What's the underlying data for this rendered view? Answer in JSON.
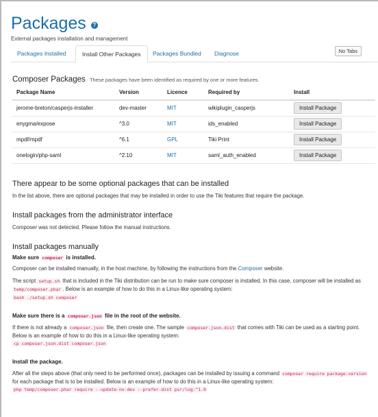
{
  "header": {
    "title": "Packages",
    "subtitle": "External packages installation and management"
  },
  "tabs": [
    {
      "label": "Packages Installed",
      "active": false
    },
    {
      "label": "Install Other Packages",
      "active": true
    },
    {
      "label": "Packages Bundled",
      "active": false
    },
    {
      "label": "Diagnose",
      "active": false
    }
  ],
  "no_tabs_label": "No Tabs",
  "composer_section": {
    "title": "Composer Packages",
    "note": "These packages have been identified as required by one or more features.",
    "columns": [
      "Package Name",
      "Version",
      "Licence",
      "Required by",
      "Install"
    ],
    "rows": [
      {
        "name": "jerome-breton/casperjs-installer",
        "version": "dev-master",
        "licence": "MIT",
        "required_by": "wikiplugin_casperjs",
        "button": "Install Package"
      },
      {
        "name": "enygma/expose",
        "version": "^3.0",
        "licence": "MIT",
        "required_by": "ids_enabled",
        "button": "Install Package"
      },
      {
        "name": "mpdf/mpdf",
        "version": "^6.1",
        "licence": "GPL",
        "required_by": "Tiki Print",
        "button": "Install Package"
      },
      {
        "name": "onelogin/php-saml",
        "version": "^2.10",
        "licence": "MIT",
        "required_by": "saml_auth_enabled",
        "button": "Install Package"
      }
    ]
  },
  "optional": {
    "title": "There appear to be some optional packages that can be installed",
    "text": "In the list above, there are optional packages that may be installed in order to use the Tiki features that require the package."
  },
  "admin": {
    "title": "Install packages from the administrator interface",
    "text": "Composer was not detected. Please follow the manual instructions."
  },
  "manual": {
    "title": "Install packages manually",
    "step1": {
      "heading_pre": "Make sure",
      "heading_code": "composer",
      "heading_post": "is installed.",
      "p1_pre": "Composer can be installed manually, in the host machine, by following the instructions from the",
      "p1_link": "Composer",
      "p1_post": "website.",
      "p2_a": "The script",
      "p2_code1": "setup.sh",
      "p2_b": "that is included in the Tiki distribution can be run to make sure composer is installed. In this case, composer will be installed as",
      "p2_code2": "temp/composer.phar",
      "p2_c": ". Below is an example of how to do this in a Linux-like operating system:",
      "cmd": "bash ./setup.sh composer"
    },
    "step2": {
      "heading_pre": "Make sure there is a",
      "heading_code": "composer.json",
      "heading_post": "file in the root of the website.",
      "p_a": "If there is not already a",
      "p_code1": "composer.json",
      "p_b": "file, then create one. The sample",
      "p_code2": "composer.json.dist",
      "p_c": "that comes with Tiki can be used as a starting point. Below is an example of how to do this in a Linux-like operating system:",
      "cmd": "cp composer.json.dist composer.json"
    },
    "step3": {
      "heading": "Install the package.",
      "p_a": "After all the steps above (that only need to be performed once), packages can be installed by issuing a command",
      "p_code1": "composer require package:version",
      "p_b": "for each package that is to be installed. Below is an example of how to do this in a Linux-like operating system:",
      "cmd": "php temp/composer.phar require --update-no-dev --prefer-dist psr/log:^1.0"
    }
  },
  "colors": {
    "link": "#1a6fa8",
    "code": "#c7254e"
  }
}
